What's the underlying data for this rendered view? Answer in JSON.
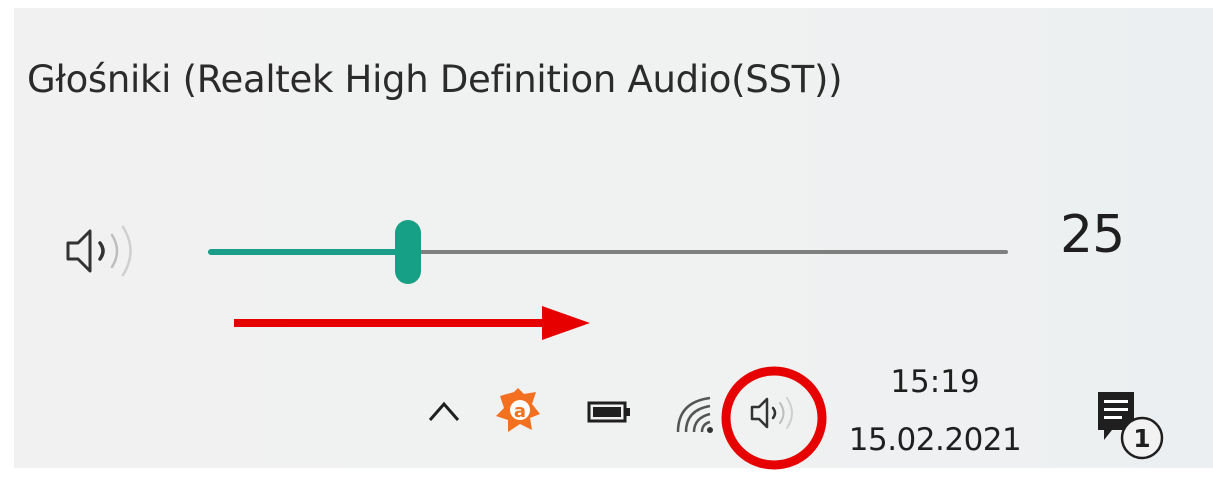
{
  "flyout": {
    "device_name": "Głośniki (Realtek High Definition Audio(SST))",
    "volume_value": "25",
    "volume_level_percent": 25,
    "icon": "speaker-volume-icon"
  },
  "annotations": {
    "arrow_color": "#e60000",
    "circle_color": "#e60000"
  },
  "taskbar": {
    "tray_icons": [
      "chevron-up-icon",
      "avast-icon",
      "battery-icon",
      "wifi-icon",
      "volume-icon"
    ],
    "clock": {
      "time": "15:19",
      "date": "15.02.2021"
    },
    "notifications": {
      "icon": "action-center-icon",
      "count": "1"
    }
  },
  "colors": {
    "slider_accent": "#16a085",
    "slider_track": "#7f7f7f",
    "avast_orange": "#f37021"
  }
}
